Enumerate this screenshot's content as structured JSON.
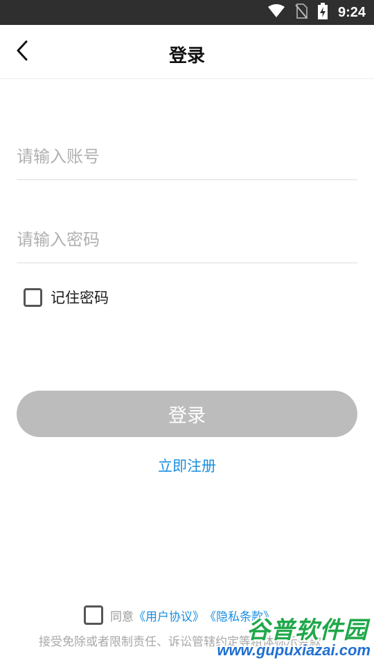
{
  "status_bar": {
    "time": "9:24",
    "icons": [
      "wifi-icon",
      "no-sim-icon",
      "battery-charging-icon"
    ]
  },
  "header": {
    "back_icon": "chevron-left-icon",
    "title": "登录"
  },
  "form": {
    "account_placeholder": "请输入账号",
    "account_value": "",
    "password_placeholder": "请输入密码",
    "password_value": "",
    "remember_label": "记住密码",
    "remember_checked": false
  },
  "actions": {
    "login_label": "登录",
    "register_label": "立即注册"
  },
  "agreement": {
    "checked": false,
    "prefix": "同意",
    "user_agreement": "《用户协议》",
    "privacy_policy": "《隐私条款》",
    "disclaimer": "接受免除或者限制责任、诉讼管辖约定等粗体标示条款"
  },
  "watermark": {
    "title": "谷普软件园",
    "url": "www.gupuxiazai.com"
  },
  "colors": {
    "status_bar": "#2f2f2f",
    "login_button_disabled": "#bcbcbc",
    "link_blue": "#1a8ee0",
    "watermark_green": "#1fa84a",
    "watermark_blue": "#1f6fd0"
  }
}
